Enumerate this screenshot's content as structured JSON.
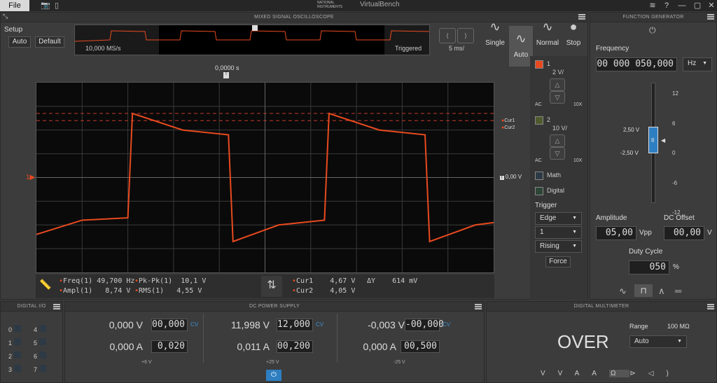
{
  "titlebar": {
    "file_label": "File",
    "app_title": "VirtualBench",
    "vendor": "NATIONAL INSTRUMENTS",
    "wifi_icon": "wifi-icon",
    "help_label": "?"
  },
  "osc": {
    "title": "MIXED SIGNAL OSCILLOSCOPE",
    "setup_label": "Setup",
    "auto_label": "Auto",
    "default_label": "Default",
    "sample_rate": "10,000 MS/s",
    "trigger_state": "Triggered",
    "timebase": "5 ms/",
    "time_offset": "0,0000 s",
    "ref_level": "0,00 V",
    "cursor1_label": "Cur1",
    "cursor2_label": "Cur2",
    "modes": [
      {
        "label": "Single"
      },
      {
        "label": "Auto"
      },
      {
        "label": "Normal"
      },
      {
        "label": "Stop"
      }
    ],
    "trace_color": "#e84a1f",
    "measurements": {
      "freq_label": "Freq(1)",
      "freq_value": "49,700 Hz",
      "pkpk_label": "Pk-Pk(1)",
      "pkpk_value": "10,1 V",
      "ampl_label": "Ampl(1)",
      "ampl_value": "8,74 V",
      "rms_label": "RMS(1)",
      "rms_value": "4,55 V",
      "cur1_label": "Cur1",
      "cur1_value": "4,67 V",
      "cur2_label": "Cur2",
      "cur2_value": "4,05 V",
      "dy_label": "ΔY",
      "dy_value": "614 mV"
    },
    "channels": [
      {
        "number": "1",
        "scale": "2 V/",
        "coupling": "AC",
        "probe": "10X",
        "color": "#e84a1f"
      },
      {
        "number": "2",
        "scale": "10 V/",
        "coupling": "AC",
        "probe": "10X",
        "color": "#4f5a2d"
      }
    ],
    "math_label": "Math",
    "digital_label": "Digital",
    "trigger": {
      "title": "Trigger",
      "type": "Edge",
      "source": "1",
      "slope": "Rising",
      "force_label": "Force"
    }
  },
  "fg": {
    "title": "FUNCTION GENERATOR",
    "frequency_label": "Frequency",
    "frequency_value": "00 000 050,000",
    "frequency_unit": "Hz",
    "scale_ticks": [
      "12",
      "6",
      "0",
      "-6",
      "-12"
    ],
    "high_level": "2,50 V",
    "low_level": "-2,50 V",
    "amplitude_label": "Amplitude",
    "amplitude_value": "05,00",
    "amplitude_unit": "Vpp",
    "offset_label": "DC Offset",
    "offset_value": "00,00",
    "offset_unit": "V",
    "duty_label": "Duty Cycle",
    "duty_value": "050",
    "duty_unit": "%"
  },
  "dio": {
    "title": "DIGITAL I/O",
    "left": [
      "0",
      "1",
      "2",
      "3"
    ],
    "right": [
      "4",
      "5",
      "6",
      "7"
    ]
  },
  "dc": {
    "title": "DC POWER SUPPLY",
    "rails": [
      {
        "v_meas": "0,000 V",
        "v_set": "00,000",
        "a_meas": "0,000 A",
        "a_set": "0,020",
        "mode": "CV",
        "rail": "+6 V"
      },
      {
        "v_meas": "11,998 V",
        "v_set": "12,000",
        "a_meas": "0,011 A",
        "a_set": "00,200",
        "mode": "CV",
        "rail": "+25 V"
      },
      {
        "v_meas": "-0,003 V",
        "v_set": "-00,000",
        "a_meas": "0,000 A",
        "a_set": "00,500",
        "mode": "CV",
        "rail": "-25 V"
      }
    ]
  },
  "dmm": {
    "title": "DIGITAL MULTIMETER",
    "reading": "OVER",
    "range_label": "Range",
    "range_value": "100 MΩ",
    "range_select": "Auto"
  },
  "chart_data": {
    "type": "line",
    "series": [
      {
        "name": "1",
        "x": [
          0,
          1,
          2,
          2.1,
          3.2,
          4.2,
          4.3,
          5.3,
          6.3,
          6.4,
          7.5,
          8.5,
          8.6,
          9.6,
          10
        ],
        "y": [
          -2.4,
          -1.8,
          -1.7,
          2.7,
          2.0,
          1.8,
          -2.7,
          -2.0,
          -1.8,
          2.7,
          2.0,
          1.8,
          -2.7,
          -2.0,
          -1.9
        ]
      }
    ],
    "xlim": [
      0,
      10
    ],
    "ylim": [
      -4,
      4
    ],
    "grid": true
  }
}
